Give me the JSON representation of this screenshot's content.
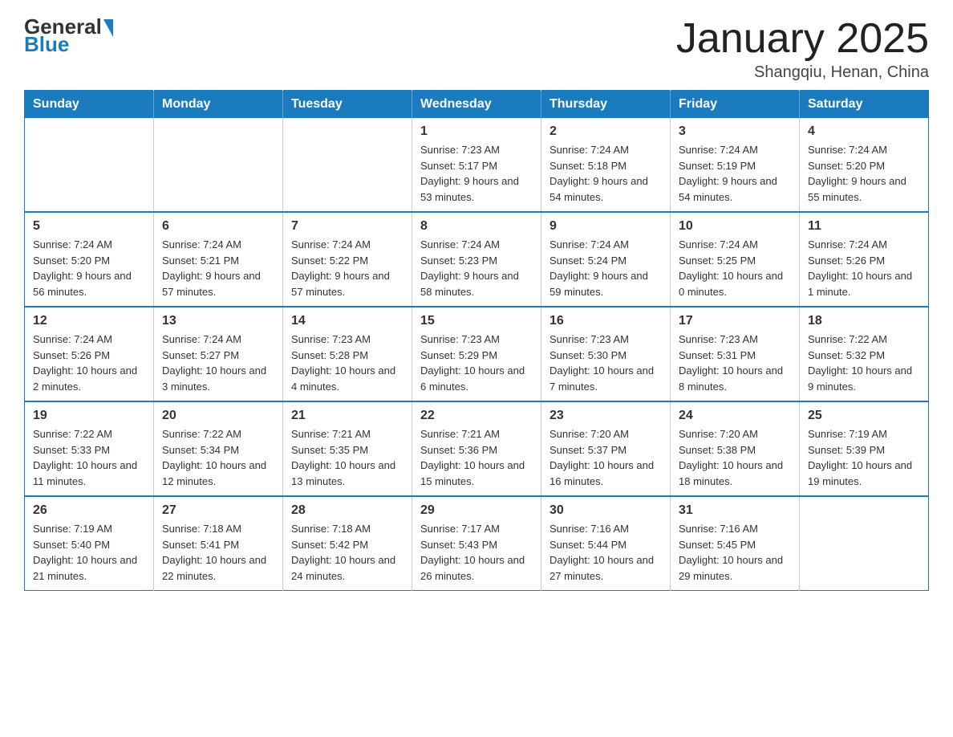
{
  "logo": {
    "general": "General",
    "blue": "Blue"
  },
  "title": "January 2025",
  "subtitle": "Shangqiu, Henan, China",
  "days_of_week": [
    "Sunday",
    "Monday",
    "Tuesday",
    "Wednesday",
    "Thursday",
    "Friday",
    "Saturday"
  ],
  "weeks": [
    [
      {
        "day": "",
        "info": ""
      },
      {
        "day": "",
        "info": ""
      },
      {
        "day": "",
        "info": ""
      },
      {
        "day": "1",
        "info": "Sunrise: 7:23 AM\nSunset: 5:17 PM\nDaylight: 9 hours and 53 minutes."
      },
      {
        "day": "2",
        "info": "Sunrise: 7:24 AM\nSunset: 5:18 PM\nDaylight: 9 hours and 54 minutes."
      },
      {
        "day": "3",
        "info": "Sunrise: 7:24 AM\nSunset: 5:19 PM\nDaylight: 9 hours and 54 minutes."
      },
      {
        "day": "4",
        "info": "Sunrise: 7:24 AM\nSunset: 5:20 PM\nDaylight: 9 hours and 55 minutes."
      }
    ],
    [
      {
        "day": "5",
        "info": "Sunrise: 7:24 AM\nSunset: 5:20 PM\nDaylight: 9 hours and 56 minutes."
      },
      {
        "day": "6",
        "info": "Sunrise: 7:24 AM\nSunset: 5:21 PM\nDaylight: 9 hours and 57 minutes."
      },
      {
        "day": "7",
        "info": "Sunrise: 7:24 AM\nSunset: 5:22 PM\nDaylight: 9 hours and 57 minutes."
      },
      {
        "day": "8",
        "info": "Sunrise: 7:24 AM\nSunset: 5:23 PM\nDaylight: 9 hours and 58 minutes."
      },
      {
        "day": "9",
        "info": "Sunrise: 7:24 AM\nSunset: 5:24 PM\nDaylight: 9 hours and 59 minutes."
      },
      {
        "day": "10",
        "info": "Sunrise: 7:24 AM\nSunset: 5:25 PM\nDaylight: 10 hours and 0 minutes."
      },
      {
        "day": "11",
        "info": "Sunrise: 7:24 AM\nSunset: 5:26 PM\nDaylight: 10 hours and 1 minute."
      }
    ],
    [
      {
        "day": "12",
        "info": "Sunrise: 7:24 AM\nSunset: 5:26 PM\nDaylight: 10 hours and 2 minutes."
      },
      {
        "day": "13",
        "info": "Sunrise: 7:24 AM\nSunset: 5:27 PM\nDaylight: 10 hours and 3 minutes."
      },
      {
        "day": "14",
        "info": "Sunrise: 7:23 AM\nSunset: 5:28 PM\nDaylight: 10 hours and 4 minutes."
      },
      {
        "day": "15",
        "info": "Sunrise: 7:23 AM\nSunset: 5:29 PM\nDaylight: 10 hours and 6 minutes."
      },
      {
        "day": "16",
        "info": "Sunrise: 7:23 AM\nSunset: 5:30 PM\nDaylight: 10 hours and 7 minutes."
      },
      {
        "day": "17",
        "info": "Sunrise: 7:23 AM\nSunset: 5:31 PM\nDaylight: 10 hours and 8 minutes."
      },
      {
        "day": "18",
        "info": "Sunrise: 7:22 AM\nSunset: 5:32 PM\nDaylight: 10 hours and 9 minutes."
      }
    ],
    [
      {
        "day": "19",
        "info": "Sunrise: 7:22 AM\nSunset: 5:33 PM\nDaylight: 10 hours and 11 minutes."
      },
      {
        "day": "20",
        "info": "Sunrise: 7:22 AM\nSunset: 5:34 PM\nDaylight: 10 hours and 12 minutes."
      },
      {
        "day": "21",
        "info": "Sunrise: 7:21 AM\nSunset: 5:35 PM\nDaylight: 10 hours and 13 minutes."
      },
      {
        "day": "22",
        "info": "Sunrise: 7:21 AM\nSunset: 5:36 PM\nDaylight: 10 hours and 15 minutes."
      },
      {
        "day": "23",
        "info": "Sunrise: 7:20 AM\nSunset: 5:37 PM\nDaylight: 10 hours and 16 minutes."
      },
      {
        "day": "24",
        "info": "Sunrise: 7:20 AM\nSunset: 5:38 PM\nDaylight: 10 hours and 18 minutes."
      },
      {
        "day": "25",
        "info": "Sunrise: 7:19 AM\nSunset: 5:39 PM\nDaylight: 10 hours and 19 minutes."
      }
    ],
    [
      {
        "day": "26",
        "info": "Sunrise: 7:19 AM\nSunset: 5:40 PM\nDaylight: 10 hours and 21 minutes."
      },
      {
        "day": "27",
        "info": "Sunrise: 7:18 AM\nSunset: 5:41 PM\nDaylight: 10 hours and 22 minutes."
      },
      {
        "day": "28",
        "info": "Sunrise: 7:18 AM\nSunset: 5:42 PM\nDaylight: 10 hours and 24 minutes."
      },
      {
        "day": "29",
        "info": "Sunrise: 7:17 AM\nSunset: 5:43 PM\nDaylight: 10 hours and 26 minutes."
      },
      {
        "day": "30",
        "info": "Sunrise: 7:16 AM\nSunset: 5:44 PM\nDaylight: 10 hours and 27 minutes."
      },
      {
        "day": "31",
        "info": "Sunrise: 7:16 AM\nSunset: 5:45 PM\nDaylight: 10 hours and 29 minutes."
      },
      {
        "day": "",
        "info": ""
      }
    ]
  ]
}
